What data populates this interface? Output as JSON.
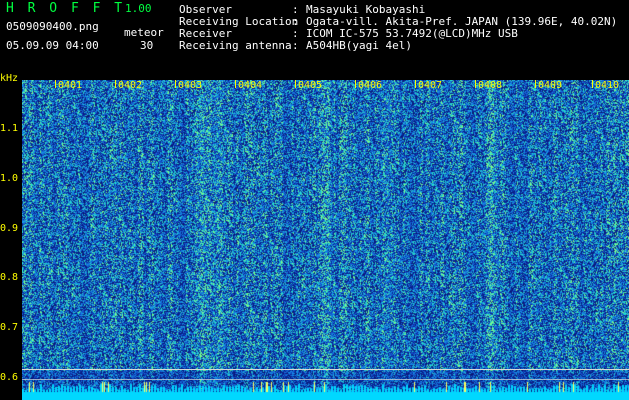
{
  "app": {
    "title": "H R O F F T",
    "version": "1.00"
  },
  "file": {
    "name": "0509090400.png",
    "datetime": "05.09.09 04:00"
  },
  "meteor": {
    "label": "meteor",
    "count": "30"
  },
  "info": [
    {
      "key": "Observer",
      "sep": ":",
      "value": "Masayuki Kobayashi"
    },
    {
      "key": "Receiving Location",
      "sep": ":",
      "value": "Ogata-vill. Akita-Pref. JAPAN (139.96E, 40.02N)"
    },
    {
      "key": "Receiver",
      "sep": ":",
      "value": "ICOM IC-575 53.7492(@LCD)MHz USB"
    },
    {
      "key": "Receiving antenna",
      "sep": ":",
      "value": "A504HB(yagi 4el)"
    }
  ],
  "y_axis": {
    "unit": "kHz",
    "ticks": [
      "1.1",
      "1.0",
      "0.9",
      "0.8",
      "0.7",
      "0.6"
    ]
  },
  "x_axis": {
    "ticks": [
      "0401",
      "0402",
      "0403",
      "0404",
      "0405",
      "0406",
      "0407",
      "0408",
      "0409",
      "0410"
    ]
  },
  "colors": {
    "label": "#ffff00",
    "background": "#000000",
    "spectrogram_low": "#0a1a8c",
    "spectrogram_high": "#40ff80"
  }
}
